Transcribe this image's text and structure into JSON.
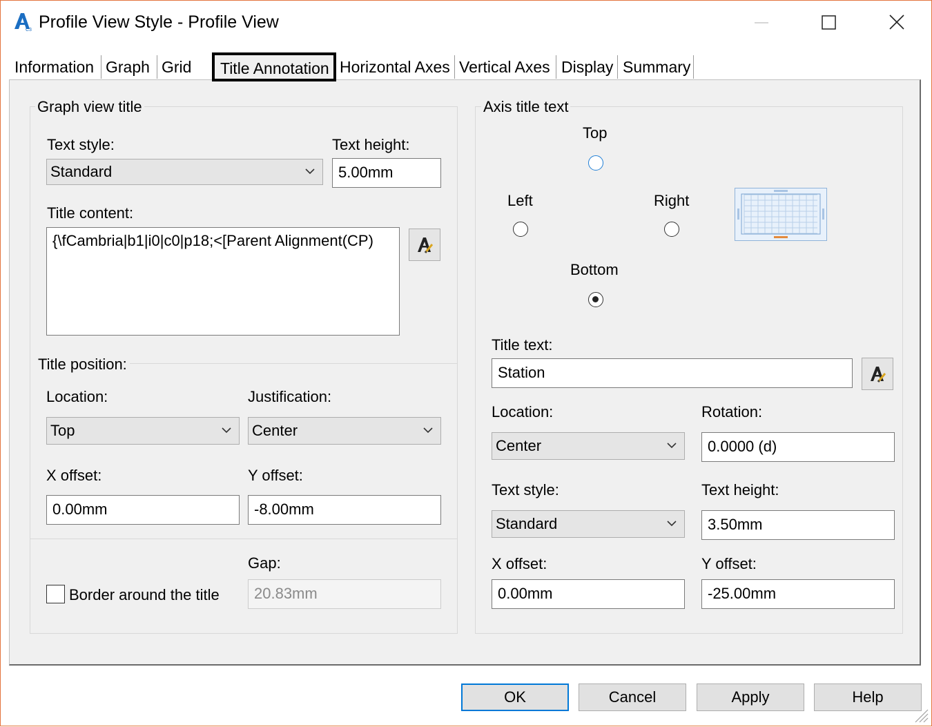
{
  "window": {
    "title": "Profile View Style - Profile View",
    "logo_icon": "autocad-civil3d-logo",
    "controls": [
      "minimize-icon",
      "maximize-icon",
      "close-icon"
    ]
  },
  "tabs": [
    {
      "label": "Information"
    },
    {
      "label": "Graph"
    },
    {
      "label": "Grid"
    },
    {
      "label": "Title Annotation",
      "selected": true
    },
    {
      "label": "Horizontal Axes"
    },
    {
      "label": "Vertical Axes"
    },
    {
      "label": "Display"
    },
    {
      "label": "Summary"
    }
  ],
  "graph_view_title": {
    "legend": "Graph view title",
    "text_style_label": "Text style:",
    "text_style_value": "Standard",
    "text_height_label": "Text height:",
    "text_height_value": "5.00mm",
    "title_content_label": "Title content:",
    "title_content_value": "{\\fCambria|b1|i0|c0|p18;<[Parent Alignment(CP)",
    "edit_icon": "text-component-editor-icon"
  },
  "title_position": {
    "legend": "Title position:",
    "location_label": "Location:",
    "location_value": "Top",
    "justification_label": "Justification:",
    "justification_value": "Center",
    "x_offset_label": "X offset:",
    "x_offset_value": "0.00mm",
    "y_offset_label": "Y offset:",
    "y_offset_value": "-8.00mm",
    "gap_label": "Gap:",
    "gap_value": "20.83mm",
    "border_label": "Border around the title",
    "border_checked": false
  },
  "axis_title_text": {
    "legend": "Axis title text",
    "top_label": "Top",
    "left_label": "Left",
    "right_label": "Right",
    "bottom_label": "Bottom",
    "selected_axis": "Bottom",
    "preview_icon": "axis-grid-preview-icon",
    "title_text_label": "Title text:",
    "title_text_value": "Station",
    "edit_icon": "text-component-editor-icon",
    "location_label": "Location:",
    "location_value": "Center",
    "rotation_label": "Rotation:",
    "rotation_value": "0.0000 (d)",
    "text_style_label": "Text style:",
    "text_style_value": "Standard",
    "text_height_label": "Text height:",
    "text_height_value": "3.50mm",
    "x_offset_label": "X offset:",
    "x_offset_value": "0.00mm",
    "y_offset_label": "Y offset:",
    "y_offset_value": "-25.00mm"
  },
  "buttons": {
    "ok": "OK",
    "cancel": "Cancel",
    "apply": "Apply",
    "help": "Help"
  },
  "colors": {
    "window_border": "#e3743d",
    "accent": "#0078d7",
    "panel_bg": "#f0f0f0"
  }
}
